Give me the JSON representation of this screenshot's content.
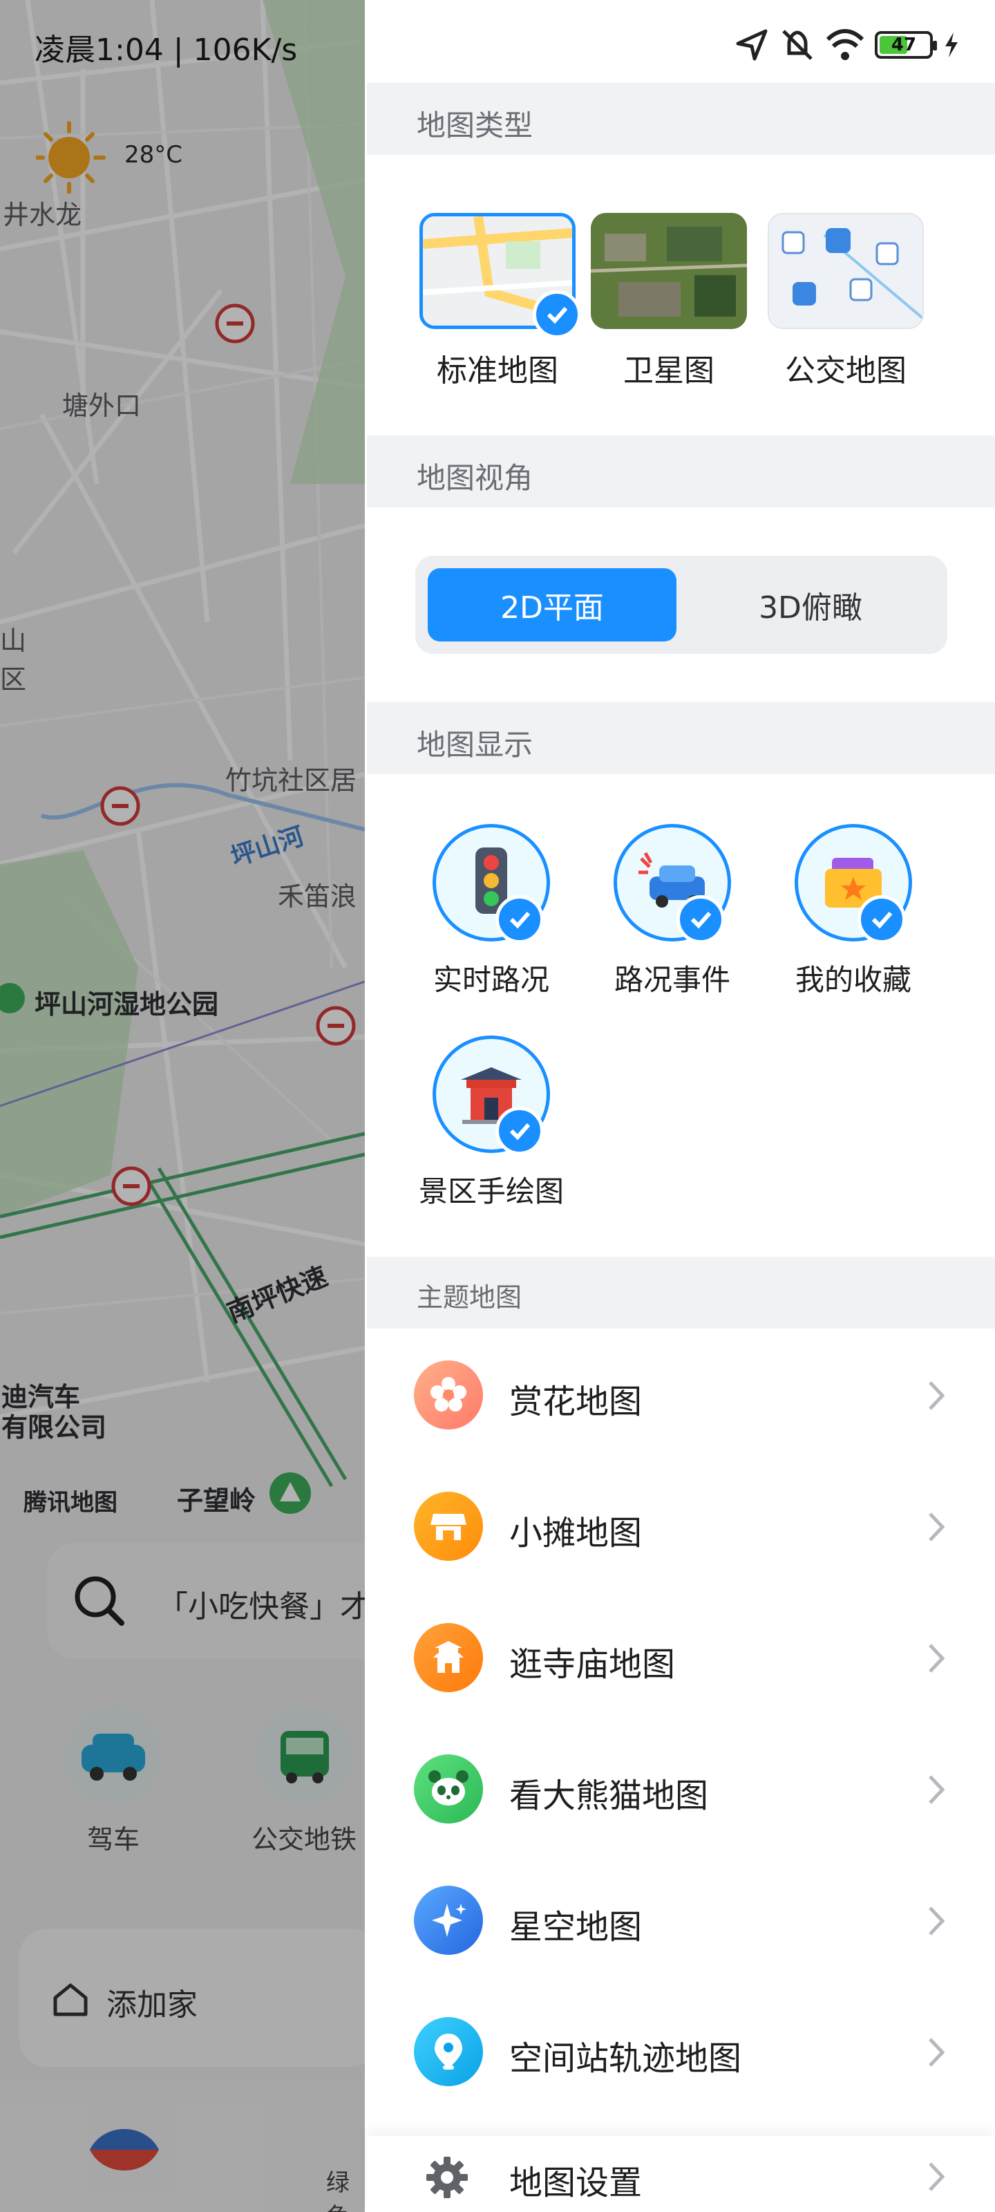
{
  "status": {
    "time_speed": "凌晨1:04 | 106K/s",
    "battery": "47"
  },
  "map": {
    "weather_temp": "28°C",
    "labels": {
      "jingshuilong": "井水龙",
      "tangwaikou": "塘外口",
      "shan": "山",
      "qu": "区",
      "zhukeng": "竹坑社区居",
      "pingshanhe": "坪山河",
      "hedi": "禾笛浪",
      "park": "坪山河湿地公园",
      "nanping": "南坪快速",
      "auto1": "迪汽车",
      "auto2": "有限公司",
      "tencent": "腾讯地图",
      "ziwangling": "子望岭"
    },
    "search_text": "「小吃快餐」才",
    "quick": {
      "drive": "驾车",
      "transit": "公交地铁"
    },
    "home": "添加家",
    "nav_green": "绿色"
  },
  "panel": {
    "map_type": {
      "title": "地图类型",
      "options": [
        {
          "label": "标准地图",
          "selected": true
        },
        {
          "label": "卫星图",
          "selected": false
        },
        {
          "label": "公交地图",
          "selected": false
        }
      ]
    },
    "view_angle": {
      "title": "地图视角",
      "option_2d": "2D平面",
      "option_3d": "3D俯瞰",
      "selected": "2D平面"
    },
    "display": {
      "title": "地图显示",
      "items": [
        {
          "label": "实时路况",
          "icon": "traffic-light-icon",
          "checked": true
        },
        {
          "label": "路况事件",
          "icon": "car-accident-icon",
          "checked": true
        },
        {
          "label": "我的收藏",
          "icon": "folder-star-icon",
          "checked": true
        },
        {
          "label": "景区手绘图",
          "icon": "temple-gate-icon",
          "checked": true
        }
      ]
    },
    "theme": {
      "title": "主题地图",
      "items": [
        {
          "label": "赏花地图",
          "icon": "flower-icon",
          "color": "#ff8a6a"
        },
        {
          "label": "小摊地图",
          "icon": "stall-icon",
          "color": "#ff9f1a"
        },
        {
          "label": "逛寺庙地图",
          "icon": "pagoda-icon",
          "color": "#ff8c1a"
        },
        {
          "label": "看大熊猫地图",
          "icon": "panda-icon",
          "color": "#3ccb68"
        },
        {
          "label": "星空地图",
          "icon": "sparkle-icon",
          "color": "#3b8cf5"
        },
        {
          "label": "空间站轨迹地图",
          "icon": "space-station-icon",
          "color": "#1ab8f0"
        }
      ]
    },
    "settings_label": "地图设置"
  }
}
